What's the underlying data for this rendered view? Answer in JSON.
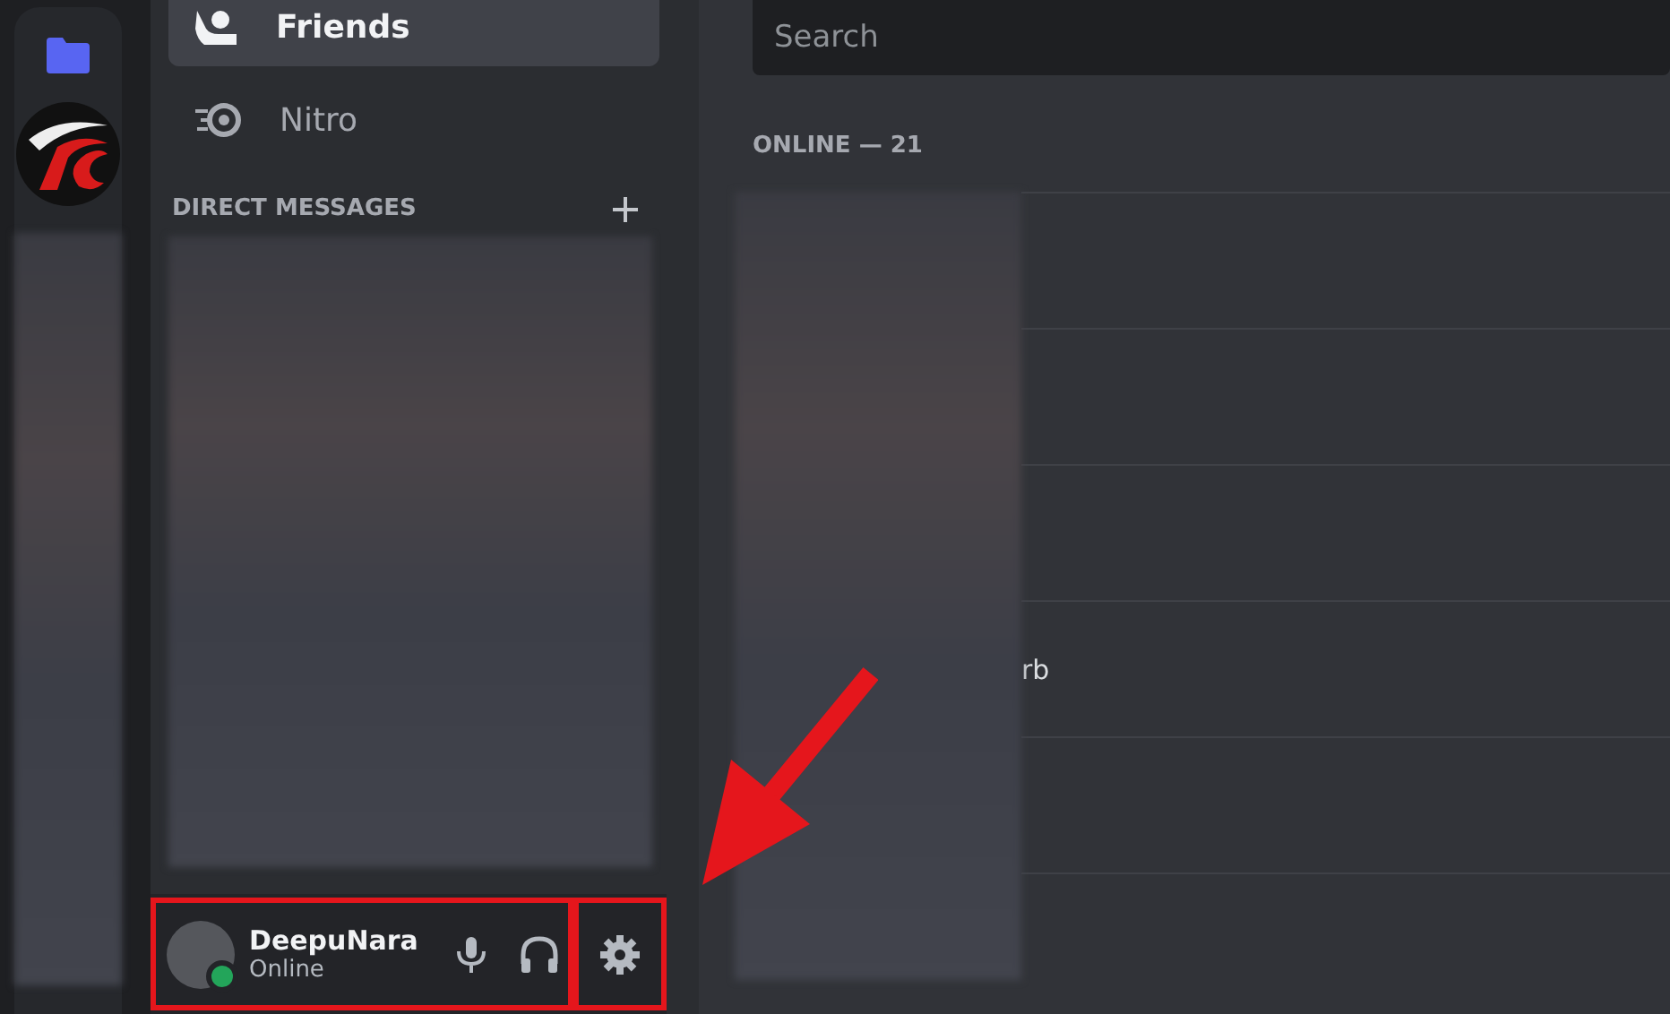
{
  "nav": [
    {
      "label": "Friends",
      "kind": "friends",
      "selected": true
    },
    {
      "label": "Nitro",
      "kind": "nitro",
      "selected": false
    }
  ],
  "direct_messages": {
    "title": "DIRECT MESSAGES"
  },
  "user_panel": {
    "name": "DeepuNara",
    "status": "Online"
  },
  "search": {
    "placeholder": "Search"
  },
  "online_header": "ONLINE — 21",
  "member_name_fragment": "rb"
}
